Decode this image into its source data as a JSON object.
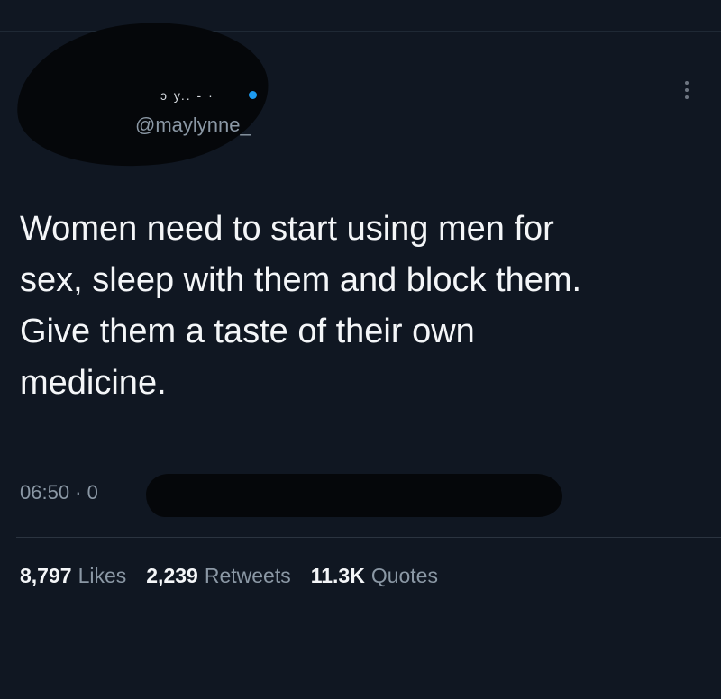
{
  "tweet": {
    "name_fragment": "ɔ y.. - ·",
    "handle": "@maylynne_",
    "text": "Women need to start using men for\nsex, sleep with them and block them.\nGive them a taste of their own\nmedicine.",
    "timestamp": "06:50 · 0",
    "stats": [
      {
        "count": "8,797",
        "label": "Likes"
      },
      {
        "count": "2,239",
        "label": "Retweets"
      },
      {
        "count": "11.3K",
        "label": "Quotes"
      }
    ]
  },
  "colors": {
    "background": "#101722",
    "text": "#f4f6f8",
    "secondary": "#8b98a5",
    "verified": "#1d9bf0"
  }
}
